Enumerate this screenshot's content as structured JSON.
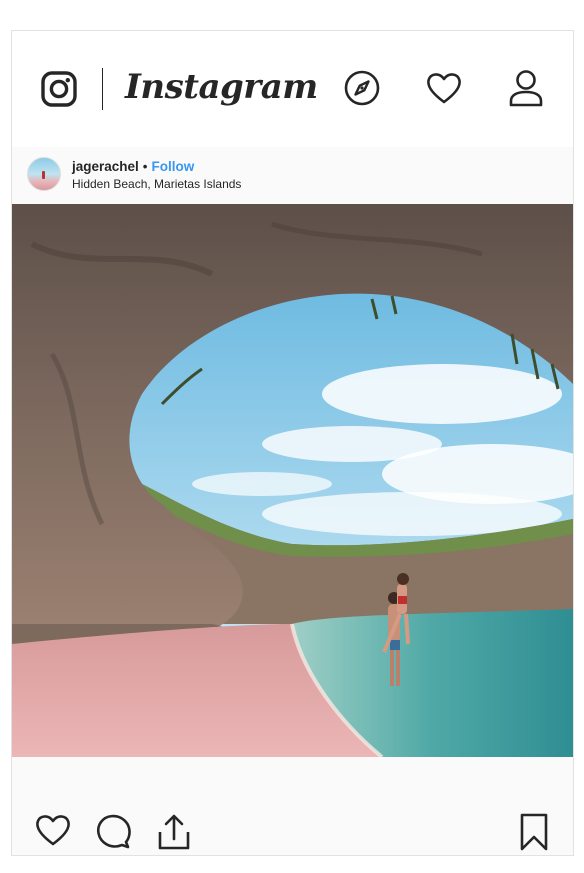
{
  "nav": {
    "brand": "Instagram",
    "icons": [
      "instagram-logo-icon",
      "explore-compass-icon",
      "activity-heart-icon",
      "profile-icon"
    ]
  },
  "post": {
    "username": "jagerachel",
    "separator": "•",
    "follow_label": "Follow",
    "location": "Hidden Beach, Marietas Islands"
  },
  "actions": {
    "icons": [
      "like-heart-icon",
      "comment-icon",
      "share-icon",
      "save-bookmark-icon"
    ]
  },
  "colors": {
    "link_blue": "#3897f0",
    "text": "#262626",
    "border": "#e2e2e2"
  }
}
